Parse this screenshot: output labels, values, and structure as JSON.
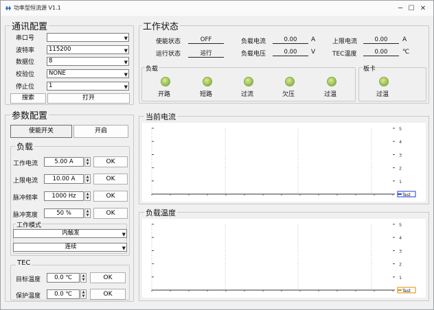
{
  "window": {
    "title": "功率型恒流源 V1.1",
    "minimize": "─",
    "maximize": "☐",
    "close": "✕"
  },
  "comm": {
    "title": "通讯配置",
    "fields": [
      {
        "label": "串口号",
        "value": ""
      },
      {
        "label": "波特率",
        "value": "115200"
      },
      {
        "label": "数据位",
        "value": "8"
      },
      {
        "label": "校验位",
        "value": "NONE"
      },
      {
        "label": "停止位",
        "value": "1"
      }
    ],
    "search_btn": "搜索",
    "open_btn": "打开"
  },
  "params": {
    "title": "参数配置",
    "enable_label": "使能开关",
    "enable_btn": "开启",
    "load": {
      "title": "负载",
      "rows": [
        {
          "label": "工作电流",
          "value": "5.00 A",
          "ok": "OK"
        },
        {
          "label": "上限电流",
          "value": "10.00 A",
          "ok": "OK"
        },
        {
          "label": "脉冲频率",
          "value": "1000 Hz",
          "ok": "OK"
        },
        {
          "label": "脉冲宽度",
          "value": "50 %",
          "ok": "OK"
        }
      ],
      "mode_title": "工作模式",
      "mode_trigger": "内触发",
      "mode_type": "连续"
    },
    "tec": {
      "title": "TEC",
      "rows": [
        {
          "label": "目标温度",
          "value": "0.0 ℃",
          "ok": "OK"
        },
        {
          "label": "保护温度",
          "value": "0.0 ℃",
          "ok": "OK"
        }
      ]
    }
  },
  "status": {
    "title": "工作状态",
    "enable_state": {
      "label": "使能状态",
      "value": "OFF"
    },
    "run_state": {
      "label": "运行状态",
      "value": "运行"
    },
    "load_current": {
      "label": "负载电流",
      "value": "0.00",
      "unit": "A"
    },
    "load_voltage": {
      "label": "负载电压",
      "value": "0.00",
      "unit": "V"
    },
    "limit_current": {
      "label": "上限电流",
      "value": "0.00",
      "unit": "A"
    },
    "tec_temp": {
      "label": "TEC温度",
      "value": "0.00",
      "unit": "℃"
    },
    "load_group": {
      "title": "负载",
      "leds": [
        "开路",
        "短路",
        "过流",
        "欠压",
        "过温"
      ]
    },
    "board_group": {
      "title": "板卡",
      "leds": [
        "过温"
      ]
    }
  },
  "chart_current": {
    "title": "当前电流",
    "legend": "Test"
  },
  "chart_temp": {
    "title": "负载温度",
    "legend": "Test"
  },
  "chart_data": [
    {
      "type": "line",
      "title": "当前电流",
      "y_ticks": [
        "5",
        "4",
        "3",
        "2",
        "1",
        "0"
      ],
      "series": [
        {
          "name": "Test",
          "values": []
        }
      ],
      "legend": "bottom-right",
      "grid": true
    },
    {
      "type": "line",
      "title": "负载温度",
      "y_ticks": [
        "5",
        "4",
        "3",
        "2",
        "1",
        "0"
      ],
      "series": [
        {
          "name": "Test",
          "values": []
        }
      ],
      "legend": "bottom-right",
      "grid": true
    }
  ],
  "colors": {
    "led_green": "#95b947",
    "legend_blue": "#1a3bd6",
    "legend_orange": "#e28a00"
  }
}
